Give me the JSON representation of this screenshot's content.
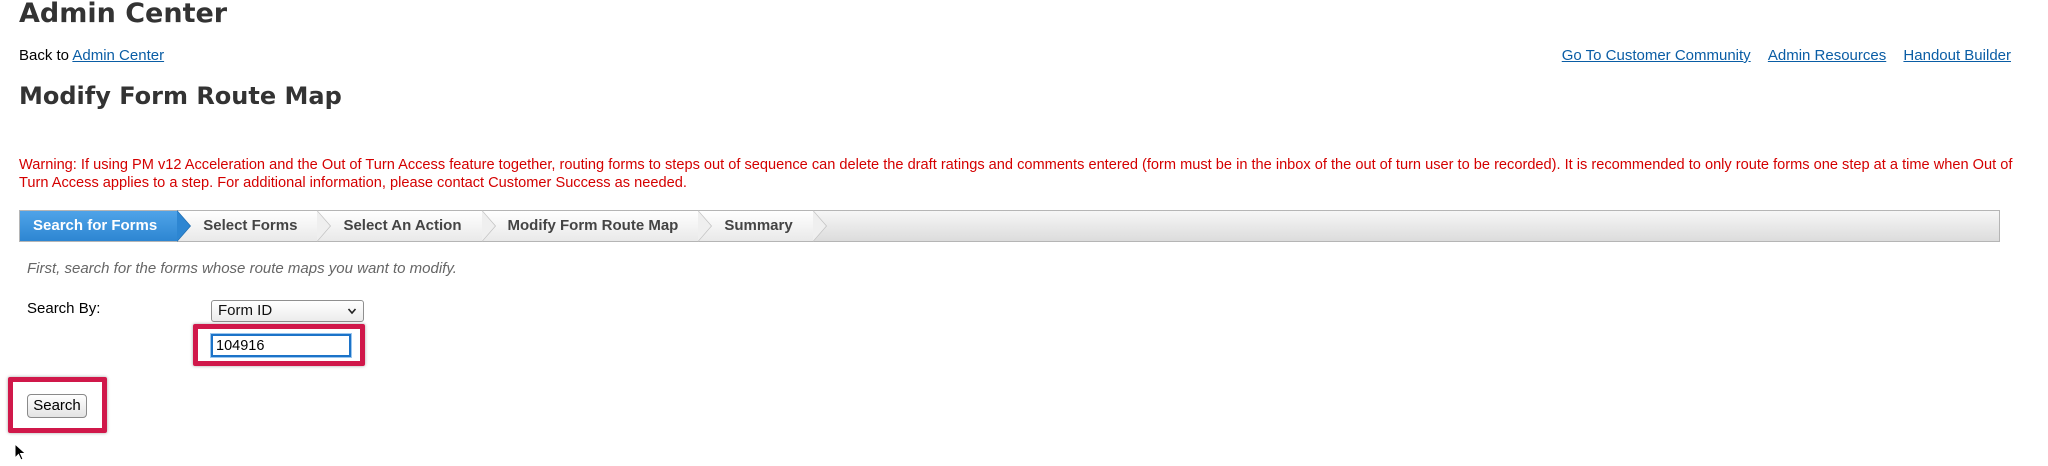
{
  "header": {
    "app_title": "Admin Center",
    "back_prefix": "Back to",
    "back_link": "Admin Center",
    "top_links": [
      "Go To Customer Community",
      "Admin Resources",
      "Handout Builder"
    ]
  },
  "page": {
    "title": "Modify Form Route Map",
    "warning": "Warning: If using PM v12 Acceleration and the Out of Turn Access feature together, routing forms to steps out of sequence can delete the draft ratings and comments entered (form must be in the inbox of the out of turn user to be recorded). It is recommended to only route forms one step at a time when Out of Turn Access applies to a step. For additional information, please contact Customer Success as needed."
  },
  "wizard": {
    "active_index": 0,
    "steps": [
      "Search for Forms",
      "Select Forms",
      "Select An Action",
      "Modify Form Route Map",
      "Summary"
    ]
  },
  "search": {
    "instruction": "First, search for the forms whose route maps you want to modify.",
    "label": "Search By:",
    "select_value": "Form ID",
    "input_value": "104916",
    "button_label": "Search"
  },
  "colors": {
    "link": "#0a5da5",
    "warning": "#d40000",
    "active_step": "#2d86d2",
    "highlight": "#d0184a"
  },
  "icons": {
    "select_chevron": "chevron-down-icon",
    "cursor": "mouse-pointer-icon"
  }
}
